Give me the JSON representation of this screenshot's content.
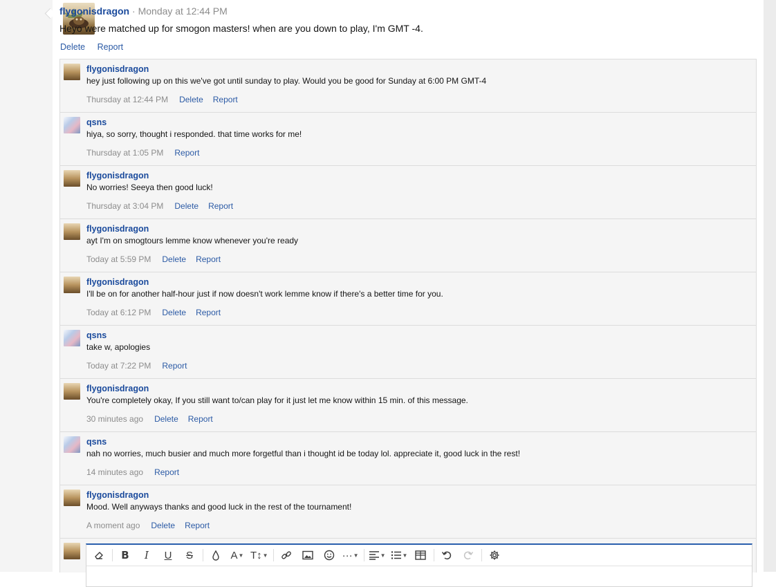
{
  "main_post": {
    "author": "flygonisdragon",
    "separator": " · ",
    "timestamp": "Monday at 12:44 PM",
    "text": "Heyo were matched up for smogon masters! when are you down to play, I'm GMT -4.",
    "actions": [
      "Delete",
      "Report"
    ]
  },
  "comments": [
    {
      "author": "flygonisdragon",
      "avatar": "flygon-avatar",
      "text": "hey just following up on this we've got until sunday to play. Would you be good for Sunday at 6:00 PM GMT-4",
      "time": "Thursday at 12:44 PM",
      "actions": [
        "Delete",
        "Report"
      ]
    },
    {
      "author": "qsns",
      "avatar": "qsns-avatar",
      "text": "hiya, so sorry, thought i responded. that time works for me!",
      "time": "Thursday at 1:05 PM",
      "actions": [
        "Report"
      ]
    },
    {
      "author": "flygonisdragon",
      "avatar": "flygon-avatar",
      "text": "No worries! Seeya then good luck!",
      "time": "Thursday at 3:04 PM",
      "actions": [
        "Delete",
        "Report"
      ]
    },
    {
      "author": "flygonisdragon",
      "avatar": "flygon-avatar",
      "text": "ayt I'm on smogtours lemme know whenever you're ready",
      "time": "Today at 5:59 PM",
      "actions": [
        "Delete",
        "Report"
      ]
    },
    {
      "author": "flygonisdragon",
      "avatar": "flygon-avatar",
      "text": "I'll be on for another half-hour just if now doesn't work lemme know if there's a better time for you.",
      "time": "Today at 6:12 PM",
      "actions": [
        "Delete",
        "Report"
      ]
    },
    {
      "author": "qsns",
      "avatar": "qsns-avatar",
      "text": "take w, apologies",
      "time": "Today at 7:22 PM",
      "actions": [
        "Report"
      ]
    },
    {
      "author": "flygonisdragon",
      "avatar": "flygon-avatar",
      "text": "You're completely okay, If you still want to/can play for it just let me know within 15 min. of this message.",
      "time": "30 minutes ago",
      "actions": [
        "Delete",
        "Report"
      ]
    },
    {
      "author": "qsns",
      "avatar": "qsns-avatar",
      "text": "nah no worries, much busier and much more forgetful than i thought id be today lol. appreciate it, good luck in the rest!",
      "time": "14 minutes ago",
      "actions": [
        "Report"
      ]
    },
    {
      "author": "flygonisdragon",
      "avatar": "flygon-avatar",
      "text": "Mood. Well anyways thanks and good luck in the rest of the tournament!",
      "time": "A moment ago",
      "actions": [
        "Delete",
        "Report"
      ]
    }
  ],
  "editor": {
    "toolbar": [
      "eraser-icon",
      "bold-icon",
      "italic-icon",
      "underline-icon",
      "strikethrough-icon",
      "text-color-icon",
      "font-family-icon",
      "font-size-icon",
      "link-icon",
      "image-icon",
      "emoji-icon",
      "more-icon",
      "align-icon",
      "list-icon",
      "table-icon",
      "undo-icon",
      "redo-icon",
      "settings-icon"
    ],
    "glyphs": {
      "bold": "B",
      "italic": "I",
      "underline": "U",
      "strike": "S",
      "font_family": "A",
      "font_size": "T↕",
      "more": "···"
    }
  },
  "colors": {
    "link": "#2b5aa5",
    "username": "#1a4a9c",
    "muted": "#8c8c8c",
    "accent": "#2a5fad"
  }
}
